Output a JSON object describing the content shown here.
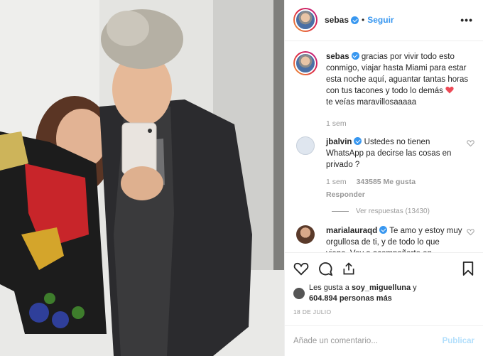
{
  "header": {
    "username": "sebas",
    "separator": "•",
    "follow_label": "Seguir",
    "more_icon": "more-icon"
  },
  "caption": {
    "username": "sebas",
    "text": "gracias por vivir todo esto conmigo, viajar hasta Miami para estar esta noche aquí, aguantar tantas horas con tus tacones y todo lo demás",
    "text2": "te veías maravillosaaaaa",
    "time": "1 sem"
  },
  "comments": [
    {
      "username": "jbalvin",
      "text": "Ustedes no tienen WhatsApp pa decirse las cosas en privado ?",
      "time": "1 sem",
      "likes": "343585 Me gusta",
      "reply": "Responder",
      "view_replies": "Ver respuestas (13430)"
    },
    {
      "username": "marialauraqd",
      "text": "Te amo y estoy muy orgullosa de ti, y de todo lo que viene. Voy a acompañarte en"
    }
  ],
  "likes": {
    "prefix": "Les gusta a",
    "user": "soy_miguelluna",
    "connector": "y",
    "count": "604.894 personas más"
  },
  "date": "18 DE JULIO",
  "comment_box": {
    "placeholder": "Añade un comentario...",
    "post_label": "Publicar"
  },
  "colors": {
    "accent": "#3897f0",
    "heart": "#ed4956",
    "muted": "#999999"
  }
}
